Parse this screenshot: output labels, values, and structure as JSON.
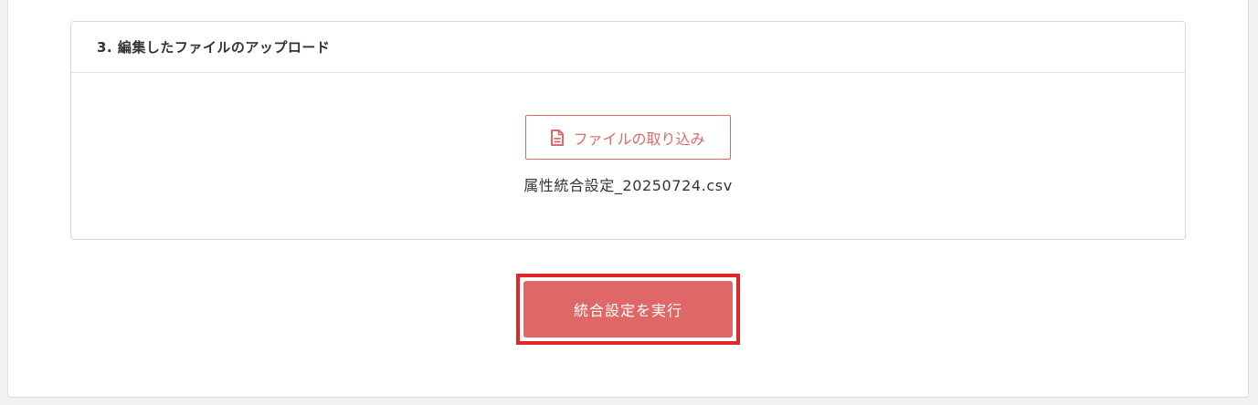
{
  "upload_section": {
    "title": "3. 編集したファイルのアップロード",
    "import_button_label": "ファイルの取り込み",
    "import_button_icon": "file-icon",
    "selected_file_name": "属性統合設定_20250724.csv"
  },
  "actions": {
    "execute_button_label": "統合設定を実行"
  },
  "colors": {
    "accent": "#e06767",
    "highlight_border": "#e0252b",
    "text": "#333333"
  }
}
